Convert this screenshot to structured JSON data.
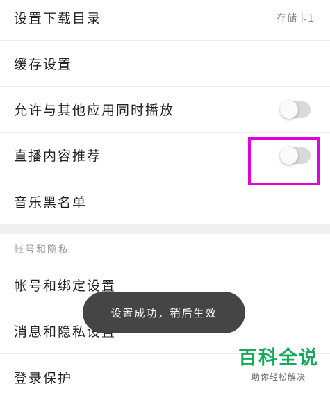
{
  "settings": {
    "download_dir": {
      "label": "设置下载目录",
      "value": "存储卡1"
    },
    "cache": {
      "label": "缓存设置"
    },
    "allow_simultaneous": {
      "label": "允许与其他应用同时播放",
      "enabled": false
    },
    "live_recommend": {
      "label": "直播内容推荐",
      "enabled": false
    },
    "blacklist": {
      "label": "音乐黑名单"
    }
  },
  "account_section": {
    "header": "帐号和隐私",
    "account_binding": {
      "label": "帐号和绑定设置"
    },
    "message_privacy": {
      "label": "消息和隐私设置"
    },
    "login_protection": {
      "label": "登录保护"
    }
  },
  "toast": {
    "text": "设置成功，稍后生效"
  },
  "watermark": {
    "main": "百科全说",
    "sub": "助你轻松解决"
  },
  "colors": {
    "highlight": "#e100d9",
    "watermark": "#17a85b",
    "toggle_off": "#d9d9d9",
    "toast_bg": "#454545"
  }
}
